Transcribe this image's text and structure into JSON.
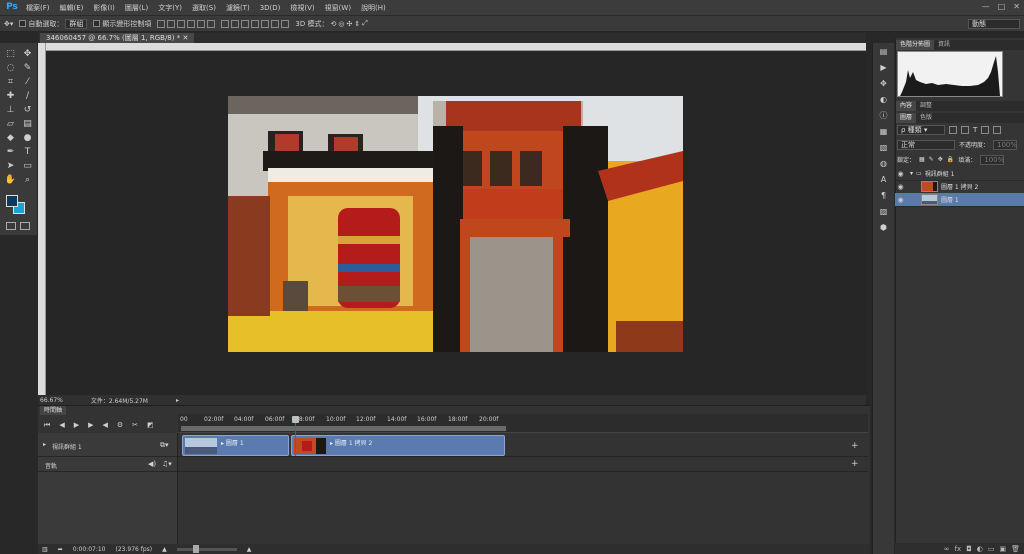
{
  "app": {
    "logo": "Ps"
  },
  "menu": [
    "檔案(F)",
    "編輯(E)",
    "影像(I)",
    "圖層(L)",
    "文字(Y)",
    "選取(S)",
    "濾鏡(T)",
    "3D(D)",
    "檢視(V)",
    "視窗(W)",
    "說明(H)"
  ],
  "window_controls": [
    "—",
    "□",
    "✕"
  ],
  "options": {
    "auto_select_label": "自動選取：",
    "auto_select_value": "群組",
    "show_transform_label": "顯示變形控制項",
    "mode_3d_label": "3D 模式：",
    "workspace": "動態"
  },
  "document": {
    "tab_title": "346060457 @ 66.7% (圖層 1, RGB/8) *"
  },
  "status": {
    "zoom": "66.67%",
    "doc_size": "文件：2.64M/5.27M"
  },
  "timeline": {
    "panel_title": "時間軸",
    "ruler_labels": [
      "00",
      "02:00f",
      "04:00f",
      "06:00f",
      "08:00f",
      "10:00f",
      "12:00f",
      "14:00f",
      "16:00f",
      "18:00f",
      "20:00f"
    ],
    "video_group_name": "視訊群組 1",
    "audio_track_name": "音軌",
    "clips": [
      {
        "label": "圖層 1"
      },
      {
        "label": "圖層 1 拷貝 2"
      }
    ],
    "timecode": "0:00:07:10",
    "fps": "(23.976 fps)"
  },
  "panels": {
    "histogram_tabs": [
      "色階分佈圖",
      "資訊"
    ],
    "props_tabs": [
      "內容",
      "調整"
    ],
    "layers_tabs": [
      "圖層",
      "色版"
    ],
    "layer_filter": "種類",
    "blend_mode": "正常",
    "opacity_label": "不透明度：",
    "opacity_value": "100%",
    "lock_label": "鎖定：",
    "fill_label": "填滿：",
    "fill_value": "100%",
    "layers": [
      {
        "name": "視訊群組 1"
      },
      {
        "name": "圖層 1 拷貝 2"
      },
      {
        "name": "圖層 1"
      }
    ]
  }
}
